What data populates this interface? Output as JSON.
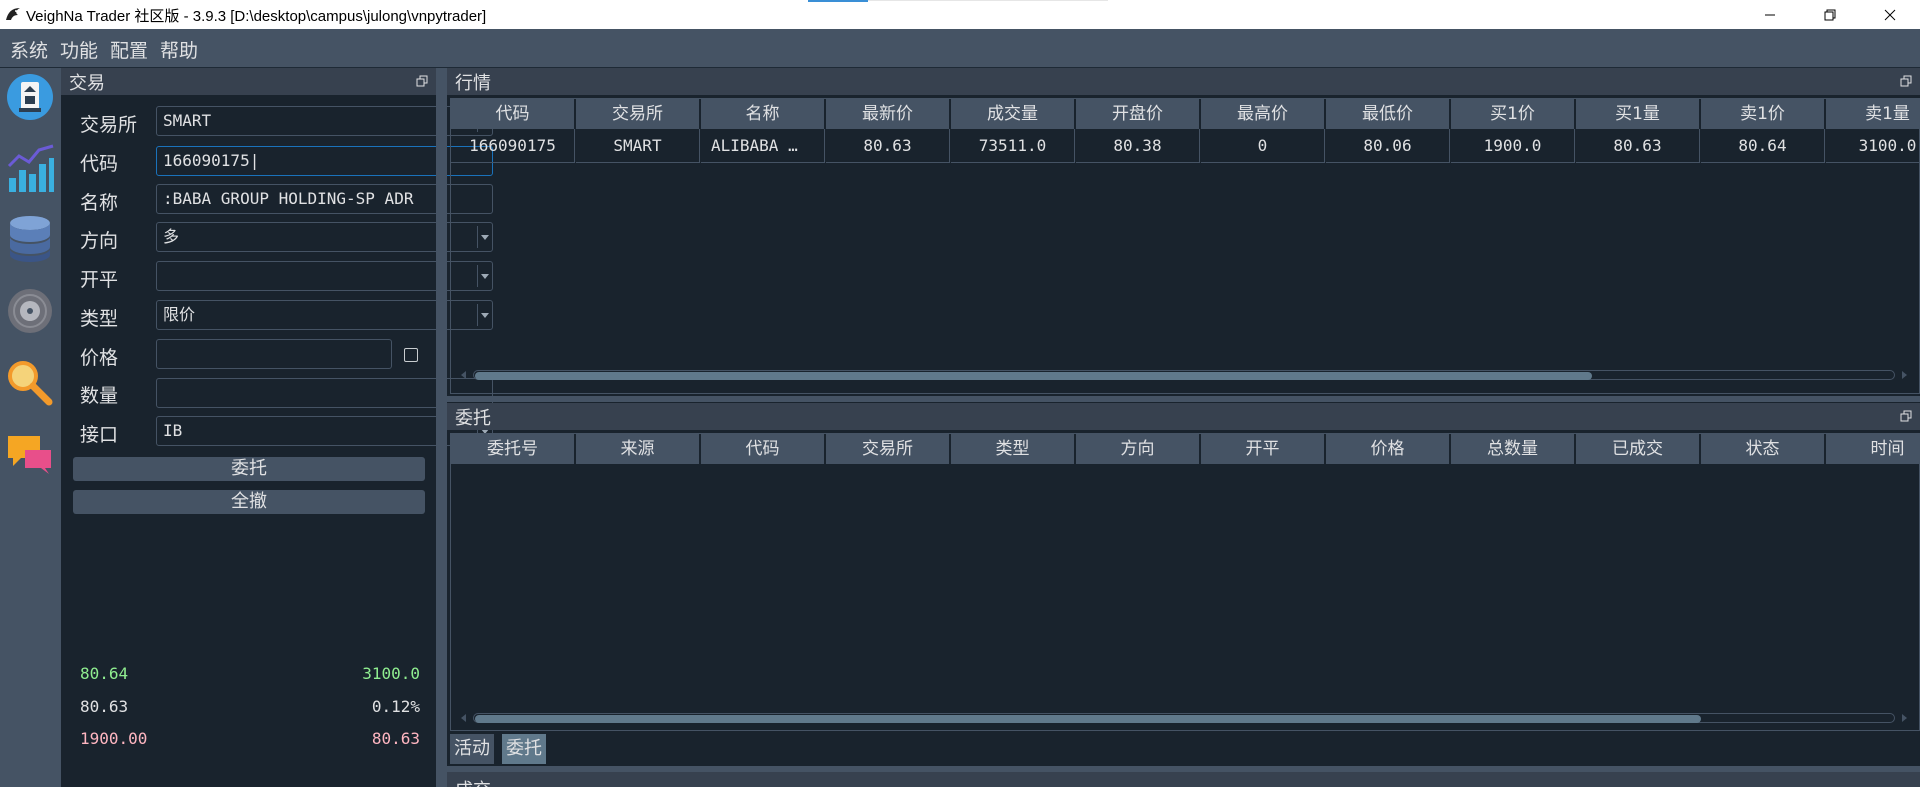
{
  "window": {
    "title": "VeighNa Trader 社区版 - 3.9.3   [D:\\desktop\\campus\\julong\\vnpytrader]"
  },
  "menu": [
    "系统",
    "功能",
    "配置",
    "帮助"
  ],
  "toolbar_icons": [
    "trader-icon",
    "chart-icon",
    "database-icon",
    "record-icon",
    "search-icon",
    "chat-icon"
  ],
  "trade": {
    "title": "交易",
    "labels": {
      "exchange": "交易所",
      "symbol": "代码",
      "name": "名称",
      "direction": "方向",
      "offset": "开平",
      "type": "类型",
      "price": "价格",
      "volume": "数量",
      "gateway": "接口"
    },
    "values": {
      "exchange": "SMART",
      "symbol": "166090175",
      "name": ":BABA GROUP HOLDING-SP ADR",
      "direction": "多",
      "offset": "",
      "type": "限价",
      "price": "",
      "volume": "",
      "gateway": "IB"
    },
    "send_button": "委托",
    "cancel_all_button": "全撤",
    "depth": {
      "ask_price": "80.64",
      "ask_volume": "3100.0",
      "last_price": "80.63",
      "change": "0.12%",
      "bid_price": "1900.00",
      "bid_volume": "80.63"
    }
  },
  "market": {
    "title": "行情",
    "columns": [
      "代码",
      "交易所",
      "名称",
      "最新价",
      "成交量",
      "开盘价",
      "最高价",
      "最低价",
      "买1价",
      "买1量",
      "卖1价",
      "卖1量"
    ],
    "rows": [
      [
        "166090175",
        "SMART",
        "ALIBABA …",
        "80.63",
        "73511.0",
        "80.38",
        "0",
        "80.06",
        "1900.0",
        "80.63",
        "80.64",
        "3100.0"
      ]
    ]
  },
  "orders": {
    "title": "委托",
    "columns": [
      "委托号",
      "来源",
      "代码",
      "交易所",
      "类型",
      "方向",
      "开平",
      "价格",
      "总数量",
      "已成交",
      "状态",
      "时间"
    ],
    "tabs": [
      "活动",
      "委托"
    ]
  },
  "trades": {
    "title": "成交"
  },
  "colors": {
    "background": "#19232d",
    "panel": "#455364",
    "ask": "#90ee90",
    "bid": "#ffb6c1",
    "focus": "#1a72bb"
  }
}
